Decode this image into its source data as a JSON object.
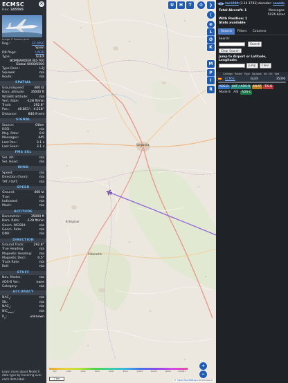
{
  "aircraft": {
    "callsign": "ECMSC",
    "hex_label": "Hex:",
    "hex": "345595",
    "photo_credit": "Image © Ramon Jordi",
    "registration_label": "Reg.:",
    "registration": "EC-MSC",
    "country": "Spain",
    "db_flags_label": "DB flags:",
    "db_flags": "LADD",
    "type_label": "Type:",
    "type": "GLEX",
    "type_full": "BOMBARDIER BD-700 Global 6000/6500",
    "type_desc_label": "Type Desc.:",
    "type_desc": "L2J",
    "squawk_label": "Squawk:",
    "squawk": "n/a",
    "route_label": "Route:",
    "route": "n/a"
  },
  "sections": {
    "spatial": "SPATIAL",
    "signal": "SIGNAL",
    "fms_sel": "FMS SEL",
    "wind": "WIND",
    "speed": "SPEED",
    "altitude": "ALTITUDE",
    "direction": "DIRECTION",
    "stuff": "STUFF",
    "accuracy": "ACCURACY"
  },
  "spatial": [
    {
      "k": "Groundspeed:",
      "v": "460 kt"
    },
    {
      "k": "Baro. altitude:",
      "v": "35000 ft"
    },
    {
      "k": "WGS84 altitude:",
      "v": "n/a"
    },
    {
      "k": "Vert. Rate:",
      "v": "-128 ft/min"
    },
    {
      "k": "Track:",
      "v": "292.8°"
    },
    {
      "k": "Pos.:",
      "v": "40.851°, -4.218°"
    },
    {
      "k": "Distance:",
      "v": "846.9 nmi"
    }
  ],
  "signal": [
    {
      "k": "Source:",
      "v": "Other"
    },
    {
      "k": "RSSI:",
      "v": "n/a"
    },
    {
      "k": "Msg. Rate:",
      "v": "0.0"
    },
    {
      "k": "Messages:",
      "v": "445"
    },
    {
      "k": "Last Pos.:",
      "v": "3.1 s"
    },
    {
      "k": "Last Seen:",
      "v": "3.1 s"
    }
  ],
  "fms": [
    {
      "k": "Sel. Alt.:",
      "v": "n/a"
    },
    {
      "k": "Sel. Head.:",
      "v": "n/a"
    }
  ],
  "wind": [
    {
      "k": "Speed:",
      "v": "n/a"
    },
    {
      "k": "Direction (from):",
      "v": "n/a"
    },
    {
      "k": "TAT / OAT:",
      "v": "n/a"
    }
  ],
  "speed": [
    {
      "k": "Ground:",
      "v": "460 kt"
    },
    {
      "k": "True:",
      "v": "n/a"
    },
    {
      "k": "Indicated:",
      "v": "n/a"
    },
    {
      "k": "Mach:",
      "v": "n/a"
    }
  ],
  "altitude": [
    {
      "k": "Barometric:",
      "v": "35000 ft"
    },
    {
      "k": "Baro. Rate:",
      "v": "-128 ft/min"
    },
    {
      "k": "Geom. WGS84:",
      "v": "n/a"
    },
    {
      "k": "Geom. Rate:",
      "v": "n/a"
    },
    {
      "k": "QNH:",
      "v": "n/a"
    }
  ],
  "direction": [
    {
      "k": "Ground Track:",
      "v": "292.8°"
    },
    {
      "k": "True Heading:",
      "v": "n/a"
    },
    {
      "k": "Magnetic Heading:",
      "v": "n/a"
    },
    {
      "k": "Magnetic Decl.:",
      "v": "0.5°"
    },
    {
      "k": "Track Rate:",
      "v": "n/a"
    },
    {
      "k": "Roll:",
      "v": "n/a"
    }
  ],
  "stuff": [
    {
      "k": "Nav. Modes:",
      "v": "n/a"
    },
    {
      "k": "ADS-B Ver.:",
      "v": "none"
    },
    {
      "k": "Category:",
      "v": "n/a"
    }
  ],
  "accuracy": [
    {
      "k": "NAC",
      "sub": "P",
      "v": "n/a"
    },
    {
      "k": "SIL:",
      "sub": "",
      "v": "n/a"
    },
    {
      "k": "NAC",
      "sub": "V",
      "v": "n/a"
    },
    {
      "k": "NIC",
      "sub": "BARO",
      "v": "n/a"
    },
    {
      "k": "R",
      "sub": "C",
      "v": "unknown"
    }
  ],
  "footer": {
    "text": "Learn more about Mode S data type by hovering over each data label."
  },
  "map": {
    "buttons": {
      "u": "U",
      "h": "H",
      "t": "T",
      "gear": "⚙",
      "collapse": "❯"
    },
    "side_buttons": [
      "⟨",
      "⊕",
      "L",
      "O",
      "K",
      "M",
      "P",
      "I",
      "R"
    ],
    "zoom_in": "+",
    "zoom_out": "−",
    "city_segovia": "Segovia",
    "city_label_2": "El Espinar",
    "city_label_3": "Villacastín",
    "altitude_ticks": [
      "500",
      "1000",
      "2000",
      "4000",
      "6000",
      "8000",
      "10000",
      "20000",
      "30000",
      "40000+"
    ],
    "scale": "2 km",
    "attribution_prefix": "© ",
    "attribution_link": "OpenStreetMap",
    "attribution_suffix": " contributors."
  },
  "sidebar": {
    "version_prefix": "tar1090",
    "version": " (3.14.1793) decoder: ",
    "version_link": "readsb",
    "total_aircraft_label": "Total Aircraft:",
    "total_aircraft": "1",
    "messages_label": "Messages:",
    "messages": "5026.6/sec",
    "with_position_label": "With Position:",
    "with_position": "1",
    "stats_available": "Stats available",
    "tabs": [
      "Search",
      "Filters",
      "Columns"
    ],
    "search_label": "Search:",
    "search_button": "Search",
    "clear_search": "Clear Search",
    "jump_label": "Jump to Airport or Latitude, Longitude:",
    "jump_button": "Jump",
    "clear_button": "Clear",
    "table_headers": [
      "Callsign",
      "Route",
      "Type",
      "Squawk",
      "Alt. (ft)",
      "Spd"
    ],
    "row": {
      "callsign": "ECMSC",
      "type": "GLEX",
      "alt": "35000"
    },
    "badges": [
      "ADS-B",
      "UAT / ADS-R",
      "MLAT",
      "TIS-B",
      "Mode-S",
      "AIS",
      "ADS-C"
    ]
  }
}
